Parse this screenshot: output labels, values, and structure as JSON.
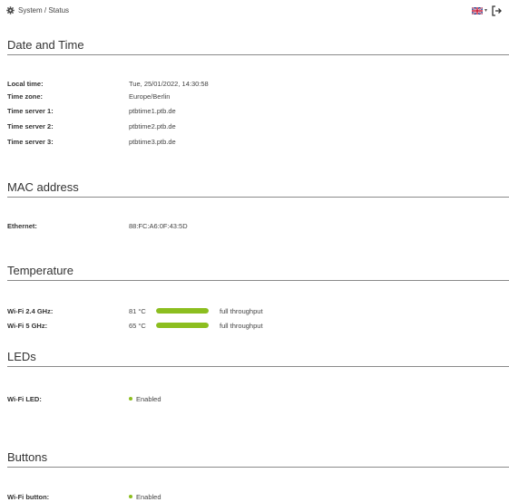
{
  "breadcrumb": "System / Status",
  "sections": {
    "datetime": {
      "title": "Date and Time",
      "rows": [
        {
          "label": "Local time:",
          "value": "Tue, 25/01/2022, 14:30:58"
        },
        {
          "label": "Time zone:",
          "value": "Europe/Berlin"
        },
        {
          "label": "Time server 1:",
          "value": "ptbtime1.ptb.de"
        },
        {
          "label": "Time server 2:",
          "value": "ptbtime2.ptb.de"
        },
        {
          "label": "Time server 3:",
          "value": "ptbtime3.ptb.de"
        }
      ]
    },
    "mac": {
      "title": "MAC address",
      "rows": [
        {
          "label": "Ethernet:",
          "value": "88:FC:A6:0F:43:5D"
        }
      ]
    },
    "temperature": {
      "title": "Temperature",
      "rows": [
        {
          "label": "Wi-Fi 2.4 GHz:",
          "temp": "81 °C",
          "status": "full throughput",
          "level": 1.0
        },
        {
          "label": "Wi-Fi 5 GHz:",
          "temp": "65 °C",
          "status": "full throughput",
          "level": 1.0
        }
      ]
    },
    "leds": {
      "title": "LEDs",
      "rows": [
        {
          "label": "Wi-Fi LED:",
          "value": "Enabled"
        }
      ]
    },
    "buttons": {
      "title": "Buttons",
      "rows": [
        {
          "label": "Wi-Fi button:",
          "value": "Enabled"
        }
      ]
    }
  },
  "colors": {
    "accent": "#8cbe1f",
    "divider": "#8a8a8a",
    "text": "#333333"
  },
  "icons": {
    "settings": "gear-icon",
    "language": "uk-flag-icon",
    "logout": "logout-icon"
  }
}
